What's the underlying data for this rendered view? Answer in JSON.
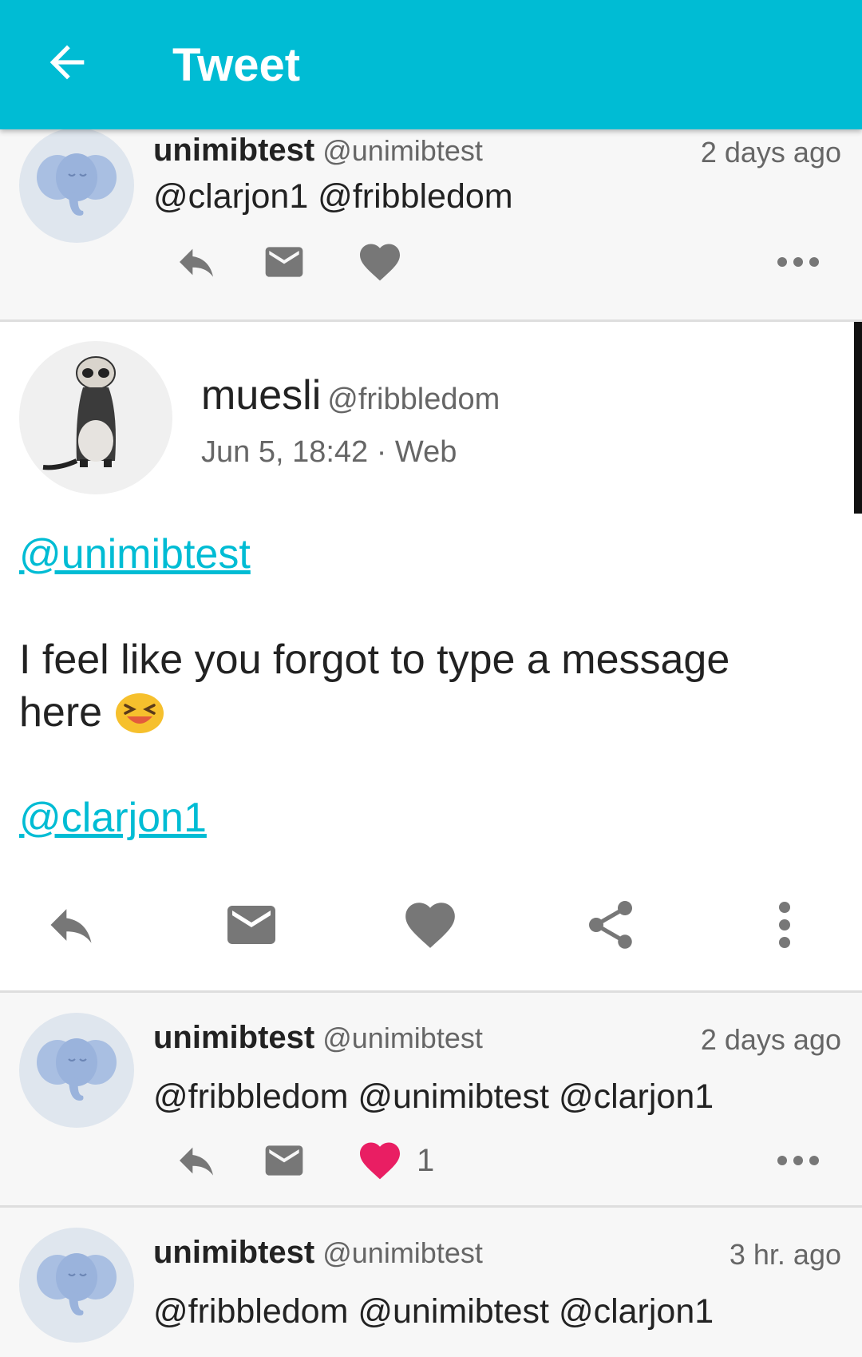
{
  "appbar": {
    "title": "Tweet",
    "back_icon": "arrow-back-icon"
  },
  "colors": {
    "accent": "#00bcd4",
    "like_active": "#e91e63",
    "icon_gray": "#777777"
  },
  "statuses": [
    {
      "name": "unimibtest",
      "handle": "@unimibtest",
      "time": "2 days ago",
      "text": "@clarjon1 @fribbledom",
      "like_count": "",
      "liked": false
    },
    {
      "name": "unimibtest",
      "handle": "@unimibtest",
      "time": "2 days ago",
      "text": "@fribbledom @unimibtest @clarjon1",
      "like_count": "1",
      "liked": true
    },
    {
      "name": "unimibtest",
      "handle": "@unimibtest",
      "time": "3 hr. ago",
      "text": "@fribbledom @unimibtest @clarjon1",
      "like_count": "",
      "liked": false
    }
  ],
  "main": {
    "name": "muesli",
    "handle": "@fribbledom",
    "meta": "Jun 5, 18:42 · Web",
    "mention_1": "@unimibtest",
    "line_1": "I feel like you forgot to type a message",
    "line_2": "here",
    "mention_2": "@clarjon1",
    "emoji": "grinning-squinting-face-emoji"
  }
}
